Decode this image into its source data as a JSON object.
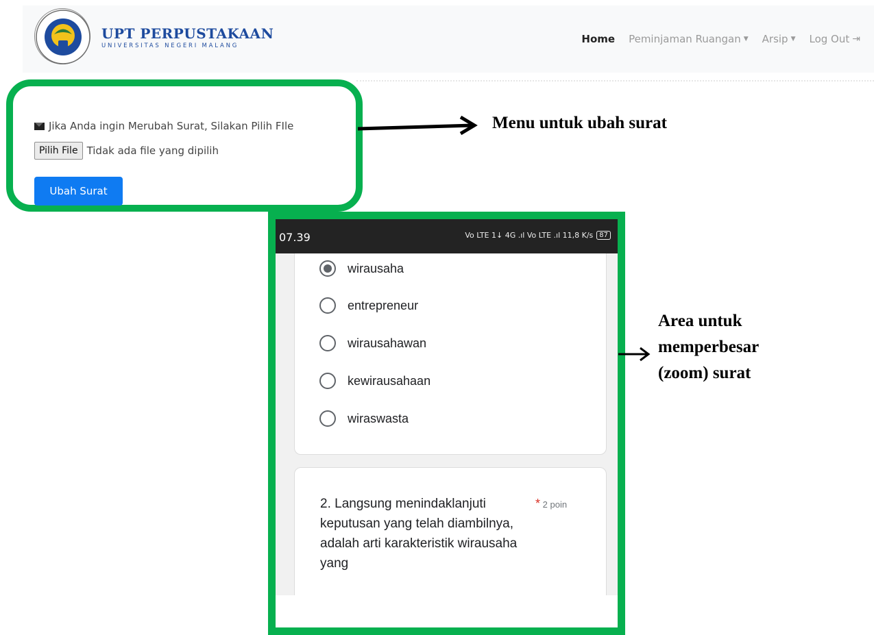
{
  "navbar": {
    "logo_title": "UPT PERPUSTAKAAN",
    "logo_subtitle": "UNIVERSITAS NEGERI MALANG",
    "items": [
      {
        "label": "Home",
        "active": true
      },
      {
        "label": "Peminjaman Ruangan",
        "dropdown": true
      },
      {
        "label": "Arsip",
        "dropdown": true
      },
      {
        "label": "Log Out",
        "icon": "logout-icon"
      }
    ]
  },
  "form": {
    "instruction": "Jika Anda ingin Merubah Surat, Silakan Pilih FIle",
    "file_button": "Pilih File",
    "file_status": "Tidak ada file yang dipilih",
    "submit_label": "Ubah Surat"
  },
  "annotations": {
    "menu_label": "Menu untuk ubah surat",
    "zoom_label_line1": "Area untuk",
    "zoom_label_line2": "memperbesar",
    "zoom_label_line3": "(zoom) surat"
  },
  "phone": {
    "time": "07.39",
    "status_icons": "Vo LTE 1↓ 4G .ıl Vo LTE .ıl 11,8 K/s",
    "battery": "87",
    "options": [
      {
        "label": "wirausaha",
        "checked": true
      },
      {
        "label": "entrepreneur",
        "checked": false
      },
      {
        "label": "wirausahawan",
        "checked": false
      },
      {
        "label": "kewirausahaan",
        "checked": false
      },
      {
        "label": "wiraswasta",
        "checked": false
      }
    ],
    "question": "2. Langsung menindaklanjuti keputusan yang telah diambilnya, adalah arti karakteristik wirausaha yang",
    "required_mark": "*",
    "points": "2 poin"
  },
  "colors": {
    "highlight_green": "#07b04f",
    "primary_button": "#0f7bf2",
    "logo_blue": "#1e4b9e"
  }
}
